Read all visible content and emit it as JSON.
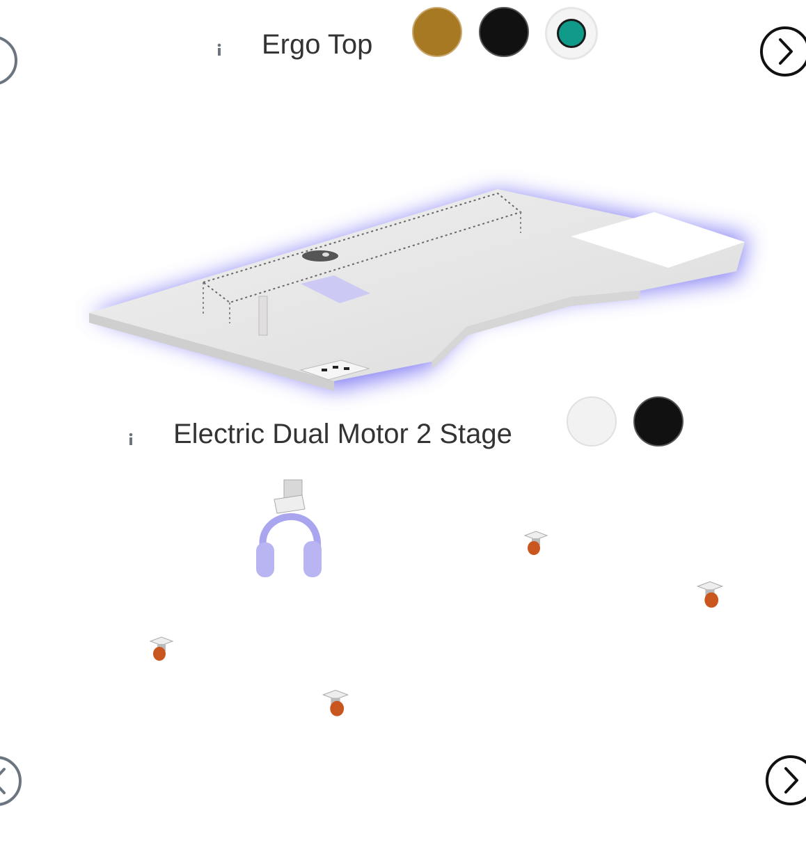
{
  "top_section": {
    "title": "Ergo Top",
    "swatches": [
      {
        "name": "gold",
        "color": "#a67922"
      },
      {
        "name": "black",
        "color": "#111111"
      },
      {
        "name": "teal",
        "color": "#0f9a8a",
        "selected": true
      }
    ]
  },
  "frame_section": {
    "title": "Electric Dual Motor 2 Stage",
    "swatches": [
      {
        "name": "white",
        "color": "#f2f2f2"
      },
      {
        "name": "black",
        "color": "#111111"
      }
    ]
  },
  "icons": {
    "info": "info-icon",
    "prev": "chevron-left-icon",
    "next": "chevron-right-icon"
  },
  "colors": {
    "glow": "#5b55f0",
    "desk": "#e8e8e8",
    "text": "#333333",
    "icon_gray": "#6b7580"
  }
}
